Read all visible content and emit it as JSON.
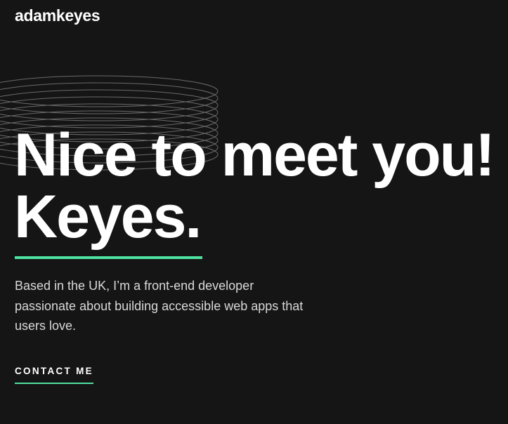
{
  "header": {
    "logo_text": "adamkeyes"
  },
  "hero": {
    "decoration_icon": "concentric-rings-pattern",
    "line1": "Nice to meet you!",
    "line2": "Keyes.",
    "intro": "Based in the UK, I’m a front-end developer passionate about building accessible web apps that users love.",
    "cta_label": "CONTACT ME"
  },
  "colors": {
    "background": "#151515",
    "text": "#ffffff",
    "body_text": "#d9d9d9",
    "accent": "#4ee1a0"
  }
}
